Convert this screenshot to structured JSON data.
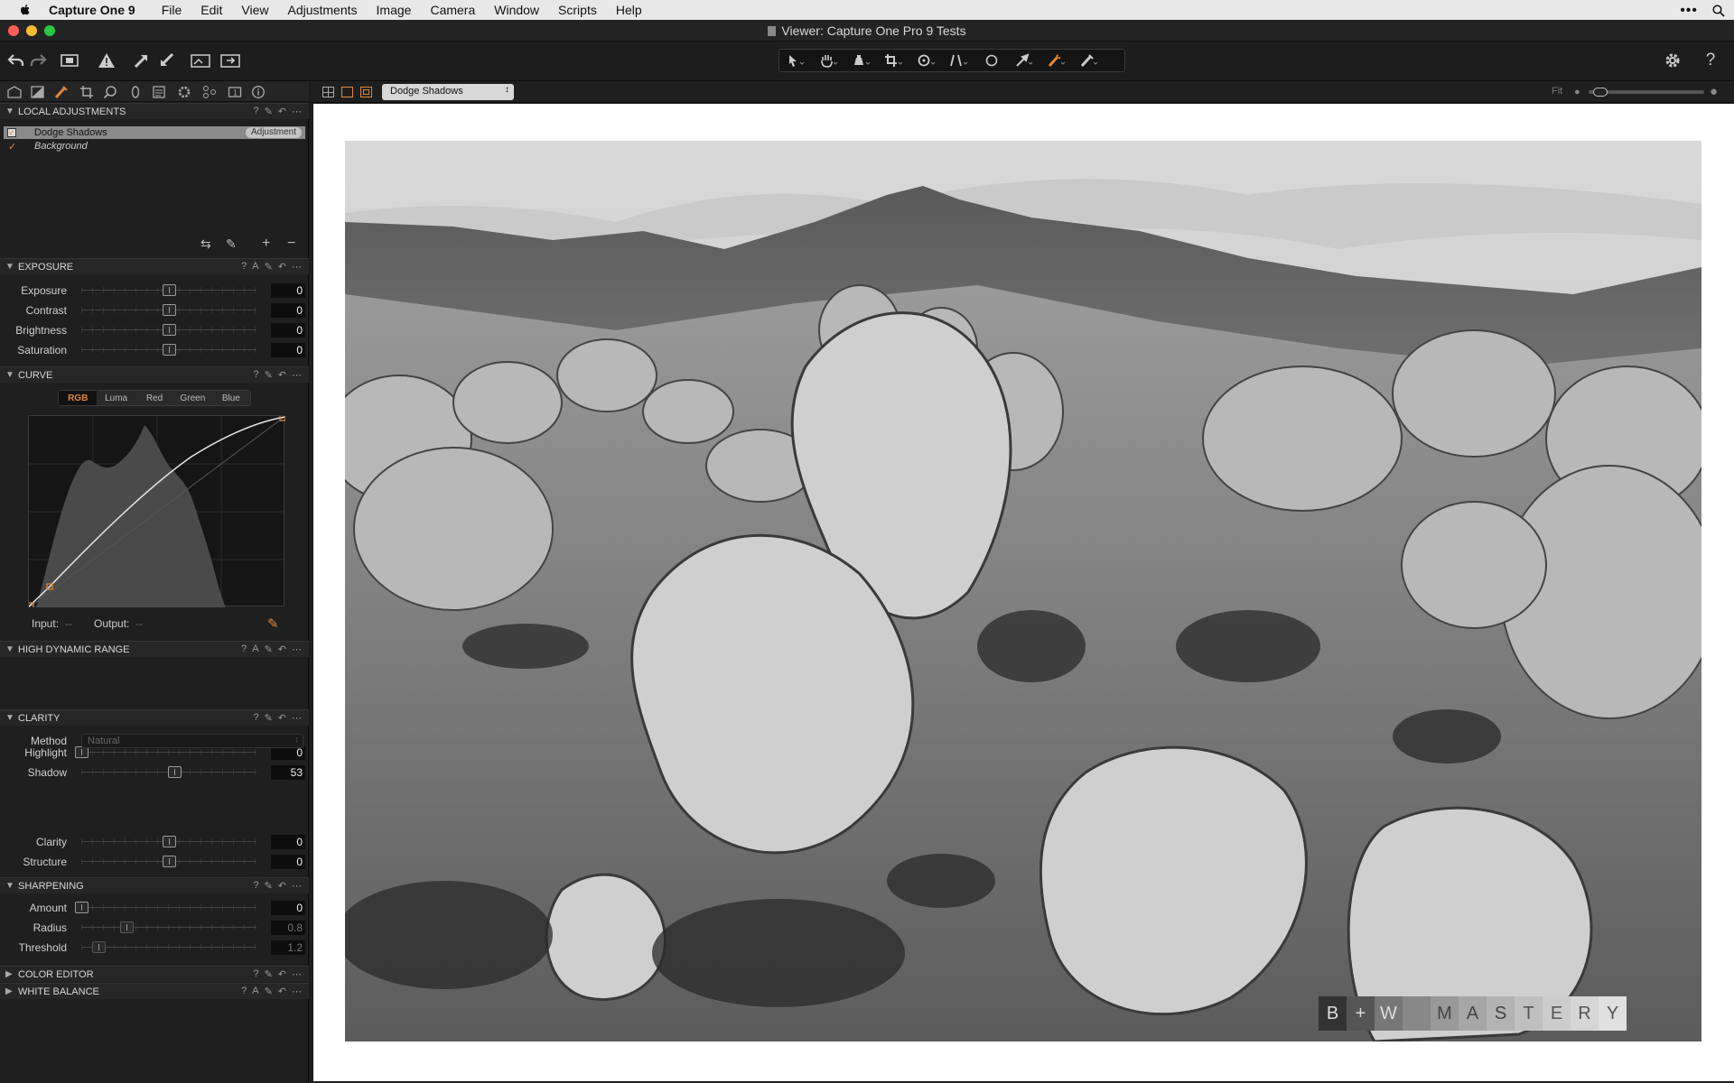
{
  "menubar": {
    "app": "Capture One 9",
    "items": [
      "File",
      "Edit",
      "View",
      "Adjustments",
      "Image",
      "Camera",
      "Window",
      "Scripts",
      "Help"
    ]
  },
  "window": {
    "title": "Viewer: Capture One Pro 9 Tests"
  },
  "viewer": {
    "variant_select": "Dodge Shadows",
    "zoom_label": "Fit",
    "watermark": [
      "B",
      "+",
      "W",
      "M",
      "A",
      "S",
      "T",
      "E",
      "R",
      "Y"
    ]
  },
  "local_adjustments": {
    "title": "Local Adjustments",
    "layers": [
      {
        "name": "Dodge Shadows",
        "badge": "Adjustment",
        "selected": true
      },
      {
        "name": "Background",
        "selected": false
      }
    ]
  },
  "exposure": {
    "title": "Exposure",
    "rows": [
      {
        "label": "Exposure",
        "value": "0",
        "pos": 0.5
      },
      {
        "label": "Contrast",
        "value": "0",
        "pos": 0.5
      },
      {
        "label": "Brightness",
        "value": "0",
        "pos": 0.5
      },
      {
        "label": "Saturation",
        "value": "0",
        "pos": 0.5
      }
    ]
  },
  "curve": {
    "title": "Curve",
    "tabs": [
      "RGB",
      "Luma",
      "Red",
      "Green",
      "Blue"
    ],
    "active_tab": "RGB",
    "input_label": "Input:",
    "input_value": "--",
    "output_label": "Output:",
    "output_value": "--"
  },
  "hdr": {
    "title": "High Dynamic Range",
    "rows": [
      {
        "label": "Highlight",
        "value": "0",
        "pos": 0.0
      },
      {
        "label": "Shadow",
        "value": "53",
        "pos": 0.53
      }
    ]
  },
  "clarity": {
    "title": "Clarity",
    "method_label": "Method",
    "method_value": "Natural",
    "rows": [
      {
        "label": "Clarity",
        "value": "0",
        "pos": 0.5
      },
      {
        "label": "Structure",
        "value": "0",
        "pos": 0.5
      }
    ]
  },
  "sharpening": {
    "title": "Sharpening",
    "rows": [
      {
        "label": "Amount",
        "value": "0",
        "pos": 0.0,
        "dim": false
      },
      {
        "label": "Radius",
        "value": "0.8",
        "pos": 0.26,
        "dim": true
      },
      {
        "label": "Threshold",
        "value": "1.2",
        "pos": 0.1,
        "dim": true
      }
    ]
  },
  "collapsed": {
    "color_editor": "Color Editor",
    "white_balance": "White Balance"
  },
  "colors": {
    "accent": "#e1863a",
    "panel": "#1f1f1f"
  }
}
